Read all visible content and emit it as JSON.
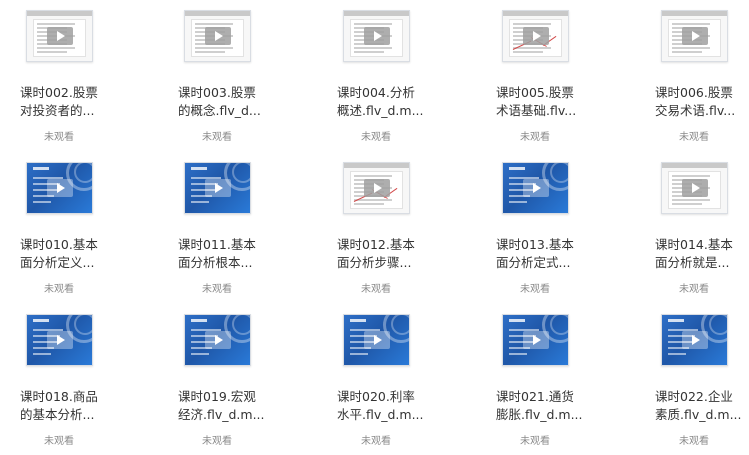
{
  "videos": [
    {
      "line1": "课时002.股票",
      "line2": "对投资者的...",
      "status": "未观看",
      "thumb": "doc"
    },
    {
      "line1": "课时003.股票",
      "line2": "的概念.flv_d...",
      "status": "未观看",
      "thumb": "doc"
    },
    {
      "line1": "课时004.分析",
      "line2": "概述.flv_d.m...",
      "status": "未观看",
      "thumb": "doc"
    },
    {
      "line1": "课时005.股票",
      "line2": "术语基础.flv...",
      "status": "未观看",
      "thumb": "doc-chart"
    },
    {
      "line1": "课时006.股票",
      "line2": "交易术语.flv...",
      "status": "未观看",
      "thumb": "doc"
    },
    {
      "line1": "课时010.基本",
      "line2": "面分析定义...",
      "status": "未观看",
      "thumb": "slide"
    },
    {
      "line1": "课时011.基本",
      "line2": "面分析根本...",
      "status": "未观看",
      "thumb": "slide"
    },
    {
      "line1": "课时012.基本",
      "line2": "面分析步骤...",
      "status": "未观看",
      "thumb": "doc-chart"
    },
    {
      "line1": "课时013.基本",
      "line2": "面分析定式...",
      "status": "未观看",
      "thumb": "slide"
    },
    {
      "line1": "课时014.基本",
      "line2": "面分析就是...",
      "status": "未观看",
      "thumb": "doc"
    },
    {
      "line1": "课时018.商品",
      "line2": "的基本分析...",
      "status": "未观看",
      "thumb": "slide"
    },
    {
      "line1": "课时019.宏观",
      "line2": "经济.flv_d.m...",
      "status": "未观看",
      "thumb": "slide"
    },
    {
      "line1": "课时020.利率",
      "line2": "水平.flv_d.m...",
      "status": "未观看",
      "thumb": "slide"
    },
    {
      "line1": "课时021.通货",
      "line2": "膨胀.flv_d.m...",
      "status": "未观看",
      "thumb": "slide"
    },
    {
      "line1": "课时022.企业",
      "line2": "素质.flv_d.m...",
      "status": "未观看",
      "thumb": "slide"
    }
  ]
}
